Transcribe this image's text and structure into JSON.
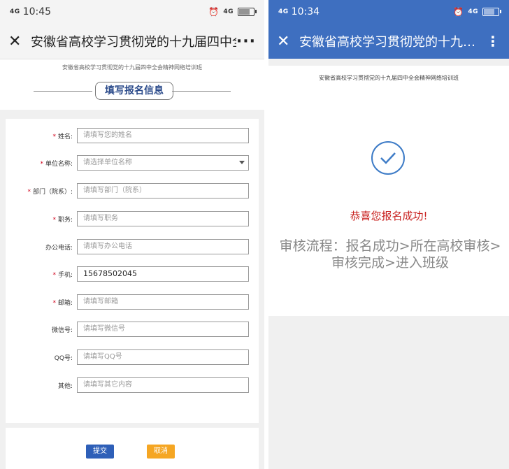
{
  "left": {
    "status": {
      "signal": "4G",
      "time": "10:45",
      "net": "4G"
    },
    "titlebar": {
      "title": "安徽省高校学习贯彻党的十九届四中全…",
      "more": "···"
    },
    "banner": {
      "subtitle": "安徽省高校学习贯彻党的十九届四中全会精神网络培训班",
      "heading": "填写报名信息"
    },
    "fields": [
      {
        "label": "姓名:",
        "required": true,
        "placeholder": "请填写您的姓名",
        "value": ""
      },
      {
        "label": "单位名称:",
        "required": true,
        "placeholder": "请选择单位名称",
        "value": "",
        "select": true
      },
      {
        "label": "部门（院系）:",
        "required": true,
        "placeholder": "请填写部门（院系）",
        "value": ""
      },
      {
        "label": "职务:",
        "required": true,
        "placeholder": "请填写职务",
        "value": ""
      },
      {
        "label": "办公电话:",
        "required": false,
        "placeholder": "请填写办公电话",
        "value": ""
      },
      {
        "label": "手机:",
        "required": true,
        "placeholder": "",
        "value": "15678502045"
      },
      {
        "label": "邮箱:",
        "required": true,
        "placeholder": "请填写邮箱",
        "value": ""
      },
      {
        "label": "微信号:",
        "required": false,
        "placeholder": "请填写微信号",
        "value": ""
      },
      {
        "label": "QQ号:",
        "required": false,
        "placeholder": "请填写QQ号",
        "value": ""
      },
      {
        "label": "其他:",
        "required": false,
        "placeholder": "请填写其它内容",
        "value": ""
      }
    ],
    "buttons": {
      "submit": "提交",
      "cancel": "取消"
    }
  },
  "right": {
    "status": {
      "signal": "4G",
      "time": "10:34",
      "net": "4G"
    },
    "titlebar": {
      "title": "安徽省高校学习贯彻党的十九…",
      "more": "⋮"
    },
    "subtitle": "安徽省高校学习贯彻党的十九届四中全会精神网络培训班",
    "success": "恭喜您报名成功!",
    "flow": "审核流程：报名成功>所在高校审核>审核完成>进入班级"
  },
  "colors": {
    "primary": "#3e6fc0",
    "submit": "#2e5fb8",
    "cancel": "#f5a623",
    "success": "#c8201e",
    "required": "#d0021b"
  }
}
